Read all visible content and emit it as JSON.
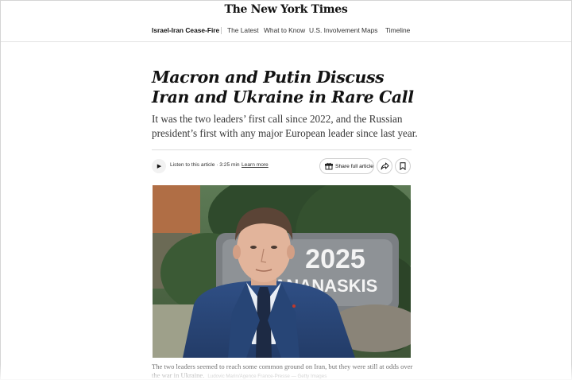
{
  "masthead": {
    "title": "The New York Times"
  },
  "nav": {
    "section": "Israel-Iran Cease-Fire",
    "items": [
      "The Latest",
      "What to Know",
      "U.S. Involvement",
      "Maps",
      "Timeline"
    ]
  },
  "article": {
    "headline": "Macron and Putin Discuss Iran and Ukraine in Rare Call",
    "dek": "It was the two leaders’ first call since 2022, and the Russian president’s first with any major European leader since last year.",
    "audio": {
      "listen_label": "Listen to this article · 3:25 min",
      "learn_more": "Learn more"
    },
    "share_full_label": "Share full article",
    "photo": {
      "sign_text_1": "2025",
      "sign_text_2": "KANANASKIS"
    },
    "caption": {
      "text": "The two leaders seemed to reach some common ground on Iran, but they were still at odds over the war in Ukraine.",
      "credit": "Ludovic Marin/Agence France-Presse — Getty Images"
    }
  },
  "icons": {
    "play": "play-icon",
    "gift": "gift-icon",
    "share": "share-arrow-icon",
    "save": "bookmark-icon"
  }
}
